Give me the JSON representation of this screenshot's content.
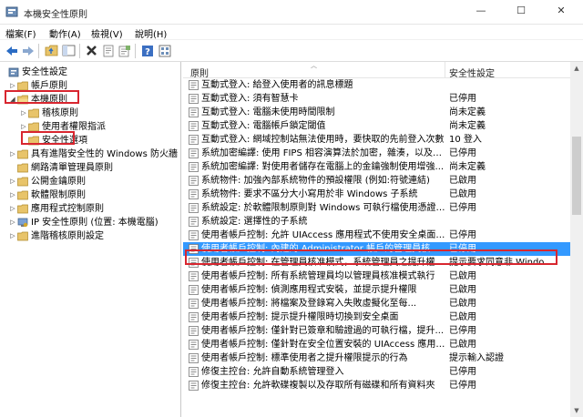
{
  "window": {
    "title": "本機安全性原則",
    "minimize": "—",
    "maximize": "☐",
    "close": "✕"
  },
  "menu": [
    "檔案(F)",
    "動作(A)",
    "檢視(V)",
    "說明(H)"
  ],
  "toolbar_icons": [
    "back-icon",
    "forward-icon",
    "up-folder-icon",
    "show-hide-tree-icon",
    "delete-icon",
    "properties-icon",
    "export-list-icon",
    "help-icon",
    "view-icon"
  ],
  "tree": [
    {
      "label": "安全性設定",
      "level": 0,
      "arrow": "",
      "icon": "security-settings-icon"
    },
    {
      "label": "帳戶原則",
      "level": 1,
      "arrow": "▷",
      "icon": "folder-icon"
    },
    {
      "label": "本機原則",
      "level": 1,
      "arrow": "◢",
      "icon": "folder-open-icon"
    },
    {
      "label": "稽核原則",
      "level": 2,
      "arrow": "▷",
      "icon": "folder-icon"
    },
    {
      "label": "使用者權限指派",
      "level": 2,
      "arrow": "▷",
      "icon": "folder-icon"
    },
    {
      "label": "安全性選項",
      "level": 2,
      "arrow": "",
      "icon": "folder-icon"
    },
    {
      "label": "具有進階安全性的 Windows 防火牆",
      "level": 1,
      "arrow": "▷",
      "icon": "folder-icon"
    },
    {
      "label": "網路清單管理員原則",
      "level": 1,
      "arrow": "",
      "icon": "folder-icon"
    },
    {
      "label": "公開金鑰原則",
      "level": 1,
      "arrow": "▷",
      "icon": "folder-icon"
    },
    {
      "label": "軟體限制原則",
      "level": 1,
      "arrow": "▷",
      "icon": "folder-icon"
    },
    {
      "label": "應用程式控制原則",
      "level": 1,
      "arrow": "▷",
      "icon": "folder-icon"
    },
    {
      "label": "IP 安全性原則 (位置: 本機電腦)",
      "level": 1,
      "arrow": "▷",
      "icon": "ip-security-icon"
    },
    {
      "label": "進階稽核原則設定",
      "level": 1,
      "arrow": "▷",
      "icon": "folder-icon"
    }
  ],
  "list": {
    "columns": {
      "policy": "原則",
      "setting": "安全性設定"
    },
    "rows": [
      {
        "policy": "互動式登入: 給登入使用者的訊息標題",
        "setting": ""
      },
      {
        "policy": "互動式登入: 須有智慧卡",
        "setting": "已停用"
      },
      {
        "policy": "互動式登入: 電腦未使用時間限制",
        "setting": "尚未定義"
      },
      {
        "policy": "互動式登入: 電腦帳戶鎖定閾值",
        "setting": "尚未定義"
      },
      {
        "policy": "互動式登入: 網域控制站無法使用時，要快取的先前登入次數",
        "setting": "10 登入"
      },
      {
        "policy": "系統加密編譯: 使用 FIPS 相容演算法於加密，雜湊，以及簽章",
        "setting": "已停用"
      },
      {
        "policy": "系統加密編譯: 對使用者儲存在電腦上的金鑰強制使用增強...",
        "setting": "尚未定義"
      },
      {
        "policy": "系統物件: 加強內部系統物件的預設權限 (例如:符號連結)",
        "setting": "已啟用"
      },
      {
        "policy": "系統物件: 要求不區分大小寫用於非 Windows 子系統",
        "setting": "已啟用"
      },
      {
        "policy": "系統設定: 於軟體限制原則對 Windows 可執行檔使用憑證規...",
        "setting": "已停用"
      },
      {
        "policy": "系統設定: 選擇性的子系統",
        "setting": ""
      },
      {
        "policy": "使用者帳戶控制: 允許 UIAccess 應用程式不使用安全桌面來...",
        "setting": "已停用"
      },
      {
        "policy": "使用者帳戶控制: 內建的 Administrator 帳戶的管理員核准模...",
        "setting": "已停用"
      },
      {
        "policy": "使用者帳戶控制: 在管理員核准模式，系統管理員之提升權...",
        "setting": "提示要求同意非 Windo..."
      },
      {
        "policy": "使用者帳戶控制: 所有系統管理員均以管理員核准模式執行",
        "setting": "已啟用"
      },
      {
        "policy": "使用者帳戶控制: 偵測應用程式安裝，並提示提升權限",
        "setting": "已啟用"
      },
      {
        "policy": "使用者帳戶控制: 將檔案及登錄寫入失敗虛擬化至每...",
        "setting": "已啟用"
      },
      {
        "policy": "使用者帳戶控制: 提示提升權限時切換到安全桌面",
        "setting": "已啟用"
      },
      {
        "policy": "使用者帳戶控制: 僅針對已簽章和驗證過的可執行檔，提升...",
        "setting": "已停用"
      },
      {
        "policy": "使用者帳戶控制: 僅針對在安全位置安裝的 UIAccess 應用程...",
        "setting": "已啟用"
      },
      {
        "policy": "使用者帳戶控制: 標準使用者之提升權限提示的行為",
        "setting": "提示輸入認證"
      },
      {
        "policy": "修復主控台: 允許自動系統管理登入",
        "setting": "已停用"
      },
      {
        "policy": "修復主控台: 允許軟碟複製以及存取所有磁碟和所有資料夾",
        "setting": "已停用"
      }
    ],
    "selected_index": 12
  },
  "colors": {
    "selection": "#3399ff",
    "highlight": "#d8262f",
    "folder": "#e8c46a"
  }
}
